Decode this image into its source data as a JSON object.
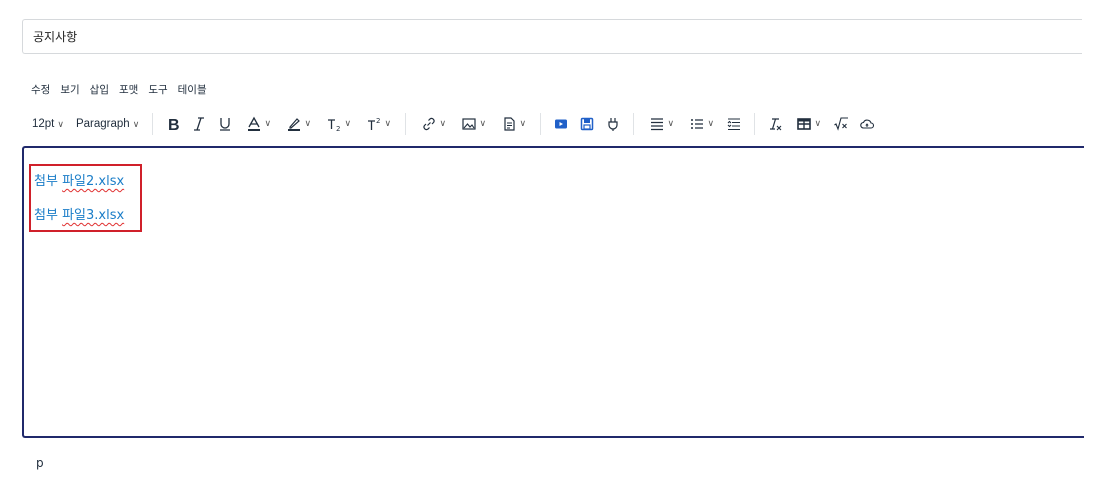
{
  "title_input": {
    "value": "공지사항"
  },
  "menubar": {
    "items": [
      "수정",
      "보기",
      "삽입",
      "포맷",
      "도구",
      "테이블"
    ]
  },
  "toolbar": {
    "font_size": "12pt",
    "block_format": "Paragraph",
    "icons": [
      "bold-icon",
      "italic-icon",
      "underline-icon",
      "text-color-icon",
      "highlight-color-icon",
      "subscript-icon",
      "superscript-icon",
      "link-icon",
      "image-icon",
      "document-icon",
      "video-icon",
      "save-icon",
      "plugin-icon",
      "align-icon",
      "bullet-list-icon",
      "line-height-icon",
      "clear-format-icon",
      "table-icon",
      "math-icon",
      "cloud-icon"
    ]
  },
  "editor": {
    "lines": [
      {
        "prefix": "첨부",
        "link": "파일2.xlsx"
      },
      {
        "prefix": "첨부",
        "link": "파일3.xlsx"
      }
    ]
  },
  "statusbar": {
    "path": "p"
  },
  "colors": {
    "editor_border": "#20296b",
    "link": "#1a7dc8",
    "highlight_box": "#d0202a",
    "spellcheck": "#e03030"
  }
}
